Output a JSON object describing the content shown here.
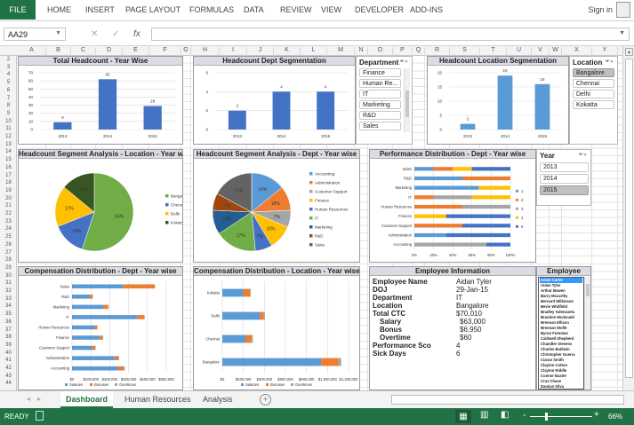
{
  "ribbon": {
    "file": "FILE",
    "tabs": [
      "HOME",
      "INSERT",
      "PAGE LAYOUT",
      "FORMULAS",
      "DATA",
      "REVIEW",
      "VIEW",
      "DEVELOPER",
      "ADD-INS"
    ],
    "sign_in": "Sign in"
  },
  "formula_bar": {
    "name_box": "AA29",
    "value": ""
  },
  "columns": [
    "A",
    "B",
    "C",
    "D",
    "E",
    "F",
    "G",
    "H",
    "I",
    "J",
    "K",
    "L",
    "M",
    "N",
    "O",
    "P",
    "Q",
    "R",
    "S",
    "T",
    "U",
    "V",
    "W",
    "X",
    "Y"
  ],
  "rows": [
    2,
    3,
    4,
    5,
    6,
    7,
    8,
    9,
    10,
    11,
    12,
    13,
    14,
    15,
    16,
    17,
    18,
    19,
    20,
    21,
    22,
    23,
    24,
    25,
    26,
    27,
    28,
    29,
    30,
    31,
    32,
    33,
    34,
    35,
    36,
    37,
    38,
    39,
    40,
    41,
    42,
    43,
    44
  ],
  "colors": {
    "accent": "#217346",
    "blue": "#4472c4",
    "lightblue": "#5b9bd5",
    "orange": "#ed7d31",
    "gray": "#a5a5a5",
    "yellow": "#ffc000",
    "green": "#70ad47"
  },
  "chart_data": [
    {
      "id": "total-headcount",
      "type": "bar",
      "title": "Total Headcount - Year Wise",
      "categories": [
        "2013",
        "2014",
        "2015"
      ],
      "values": [
        9,
        62,
        29
      ],
      "ylim": [
        0,
        70
      ],
      "ystep": 10,
      "color": "#4472c4"
    },
    {
      "id": "dept-segmentation",
      "type": "bar",
      "title": "Headcount Dept Segmentation",
      "categories": [
        "2013",
        "2014",
        "2015"
      ],
      "values": [
        2,
        4,
        4
      ],
      "ylim": [
        0,
        6
      ],
      "ystep": 2,
      "color": "#4472c4"
    },
    {
      "id": "location-segmentation",
      "type": "bar",
      "title": "Headcount Location Segmentation",
      "categories": [
        "2013",
        "2014",
        "2015"
      ],
      "values": [
        2,
        19,
        16
      ],
      "ylim": [
        0,
        20
      ],
      "ystep": 5,
      "color": "#5b9bd5"
    },
    {
      "id": "pie-location",
      "type": "pie",
      "title": "Headcount Segment Analysis - Location - Year wise",
      "labels": [
        "Bangalore",
        "Chennai",
        "Delhi",
        "Kokatta"
      ],
      "values": [
        55,
        14,
        17,
        14
      ],
      "colors": [
        "#70ad47",
        "#4472c4",
        "#ffc000",
        "#375623"
      ]
    },
    {
      "id": "pie-dept",
      "type": "pie",
      "title": "Headcount Segment Analysis - Dept - Year wise",
      "labels": [
        "Accounting",
        "Administration",
        "Customer Support",
        "Finance",
        "Human Resources",
        "IT",
        "Marketing",
        "R&D",
        "Sales"
      ],
      "values": [
        14,
        10,
        7,
        10,
        7,
        17,
        10,
        7,
        17
      ],
      "colors": [
        "#5b9bd5",
        "#ed7d31",
        "#a5a5a5",
        "#ffc000",
        "#4472c4",
        "#70ad47",
        "#255e91",
        "#9e480e",
        "#636363"
      ]
    },
    {
      "id": "performance",
      "type": "bar",
      "stacked": "percent",
      "title": "Performance Distribution - Dept - Year wise",
      "categories": [
        "Accounting",
        "Administration",
        "Customer Support",
        "Finance",
        "Human Resources",
        "IT",
        "Marketing",
        "R&D",
        "Sales"
      ],
      "series": [
        {
          "name": "1",
          "color": "#5b9bd5",
          "values": [
            0,
            33,
            0,
            0,
            0,
            0,
            67,
            50,
            20
          ]
        },
        {
          "name": "2",
          "color": "#ed7d31",
          "values": [
            0,
            0,
            50,
            0,
            50,
            20,
            0,
            50,
            20
          ]
        },
        {
          "name": "3",
          "color": "#a5a5a5",
          "values": [
            75,
            0,
            0,
            0,
            50,
            40,
            0,
            0,
            0
          ]
        },
        {
          "name": "4",
          "color": "#ffc000",
          "values": [
            0,
            0,
            0,
            33,
            0,
            40,
            33,
            0,
            20
          ]
        },
        {
          "name": "5",
          "color": "#4472c4",
          "values": [
            25,
            67,
            50,
            67,
            0,
            0,
            0,
            0,
            40
          ]
        }
      ],
      "xlim": [
        0,
        100
      ],
      "xstep": 20,
      "xfmt": "pct",
      "legend": "right"
    },
    {
      "id": "comp-dept",
      "type": "bar",
      "stacked": "stacked",
      "title": "Compensation Distribution - Dept - Year wise",
      "categories": [
        "Accounting",
        "Administration",
        "Customer Support",
        "Finance",
        "Human Resources",
        "IT",
        "Marketing",
        "R&D",
        "Sales"
      ],
      "series": [
        {
          "name": "Salaries",
          "color": "#5b9bd5",
          "values": [
            245000,
            225000,
            110000,
            145000,
            120000,
            345000,
            165000,
            95000,
            270000
          ]
        },
        {
          "name": "Bonuses",
          "color": "#ed7d31",
          "values": [
            30000,
            20000,
            15000,
            15000,
            15000,
            40000,
            25000,
            15000,
            170000
          ]
        },
        {
          "name": "Overtimes",
          "color": "#a5a5a5",
          "values": [
            5000,
            5000,
            0,
            5000,
            0,
            0,
            5000,
            0,
            0
          ]
        }
      ],
      "xlim": [
        0,
        500000
      ],
      "xstep": 100000,
      "xfmt": "usd",
      "legend": "bottom"
    },
    {
      "id": "comp-location",
      "type": "bar",
      "stacked": "stacked",
      "title": "Compensation Distribution - Location - Year wise",
      "categories": [
        "Bangalore",
        "Chennai",
        "Delhi",
        "Kokatta"
      ],
      "series": [
        {
          "name": "Salaries",
          "color": "#5b9bd5",
          "values": [
            940000,
            220000,
            355000,
            200000
          ]
        },
        {
          "name": "Bonuses",
          "color": "#ed7d31",
          "values": [
            165000,
            60000,
            40000,
            65000
          ]
        },
        {
          "name": "Overtimes",
          "color": "#a5a5a5",
          "values": [
            25000,
            10000,
            10000,
            5000
          ]
        }
      ],
      "xlim": [
        0,
        1200000
      ],
      "xstep": 200000,
      "xfmt": "usd",
      "legend": "bottom"
    }
  ],
  "slicers": {
    "department": {
      "title": "Department",
      "items": [
        "Finance",
        "Human Re...",
        "IT",
        "Marketing",
        "R&D",
        "Sales"
      ]
    },
    "location": {
      "title": "Location",
      "items": [
        "Bangalore",
        "Chennai",
        "Delhi",
        "Kokatta"
      ],
      "selected": "Bangalore"
    },
    "year": {
      "title": "Year",
      "items": [
        "2013",
        "2014",
        "2015"
      ],
      "selected": "2015"
    }
  },
  "employee_info": {
    "title": "Employee Information",
    "fields": [
      {
        "label": "Employee Name",
        "value": "Aidan Tyler"
      },
      {
        "label": "DOJ",
        "value": "29-Jan-15"
      },
      {
        "label": "Department",
        "value": "IT"
      },
      {
        "label": "Location",
        "value": "Bangalore"
      },
      {
        "label": "Total CTC",
        "value": "$70,010"
      },
      {
        "label": "Salary",
        "value": "$63,000"
      },
      {
        "label": "Bonus",
        "value": "$6,950"
      },
      {
        "label": "Overtime",
        "value": "$60"
      },
      {
        "label": "Performance Sco",
        "value": "4"
      },
      {
        "label": "Sick Days",
        "value": "6"
      }
    ]
  },
  "employee_list": {
    "title": "Employee",
    "items": [
      "Adam Carter",
      "Aidan Tyler",
      "Arthur Bowen",
      "Barry Mccarthy",
      "Bernard Wilkinson",
      "Bevis Whitfield",
      "Bradley Valenzuela",
      "Brandon Mcdonald",
      "Brennan Ellison",
      "Brennan Wolfe",
      "Byron Foreman",
      "Caldwell Shepherd",
      "Chandler Stevens",
      "Charles Baldwin",
      "Christopher Guerra",
      "Ciaran Smith",
      "Clayton Cotton",
      "Clayton Riddle",
      "Connor Baxter",
      "Cruz Chase",
      "Damian Silva"
    ],
    "selected": "Adam Carter"
  },
  "sheet_tabs": [
    "Dashboard",
    "Human Resources",
    "Analysis"
  ],
  "active_tab": "Dashboard",
  "status": {
    "ready": "READY",
    "zoom": "66%"
  }
}
